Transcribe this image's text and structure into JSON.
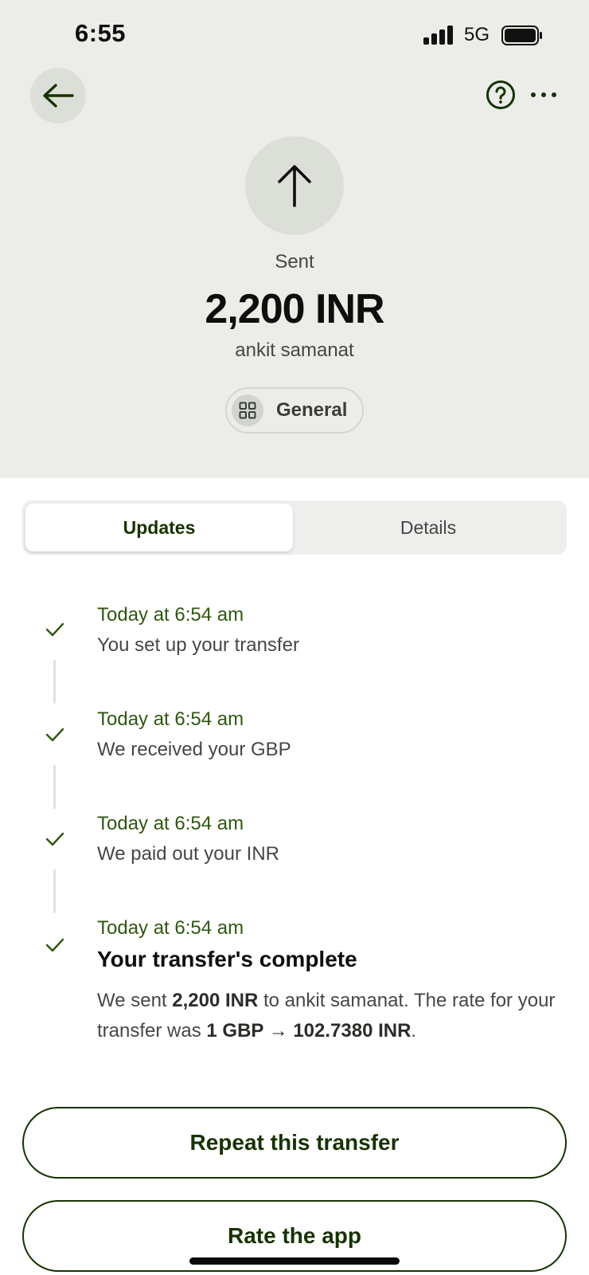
{
  "status_bar": {
    "time": "6:55",
    "network": "5G",
    "signal_icon": "cellular-signal-icon",
    "battery_icon": "battery-icon"
  },
  "nav": {
    "back_icon": "arrow-left-icon",
    "help_icon": "question-circle-icon",
    "more_icon": "more-horizontal-icon"
  },
  "transfer": {
    "direction_icon": "arrow-up-icon",
    "status": "Sent",
    "amount": "2,200 INR",
    "recipient": "ankit samanat",
    "category_icon": "grid-icon",
    "category": "General"
  },
  "tabs": {
    "updates": "Updates",
    "details": "Details",
    "active": "updates"
  },
  "timeline": [
    {
      "time": "Today at 6:54 am",
      "text": "You set up your transfer",
      "done": true
    },
    {
      "time": "Today at 6:54 am",
      "text": "We received your GBP",
      "done": true
    },
    {
      "time": "Today at 6:54 am",
      "text": "We paid out your INR",
      "done": true
    },
    {
      "time": "Today at 6:54 am",
      "title": "Your transfer's complete",
      "desc_1": "We sent ",
      "desc_amount": "2,200 INR",
      "desc_2": " to ankit samanat. The rate for your transfer was ",
      "desc_rate": "1 GBP → 102.7380 INR",
      "desc_3": ".",
      "done": true
    }
  ],
  "actions": {
    "repeat": "Repeat this transfer",
    "rate": "Rate the app"
  },
  "colors": {
    "header_bg": "#ecede8",
    "accent_green": "#163300",
    "timeline_green": "#2f5711"
  }
}
